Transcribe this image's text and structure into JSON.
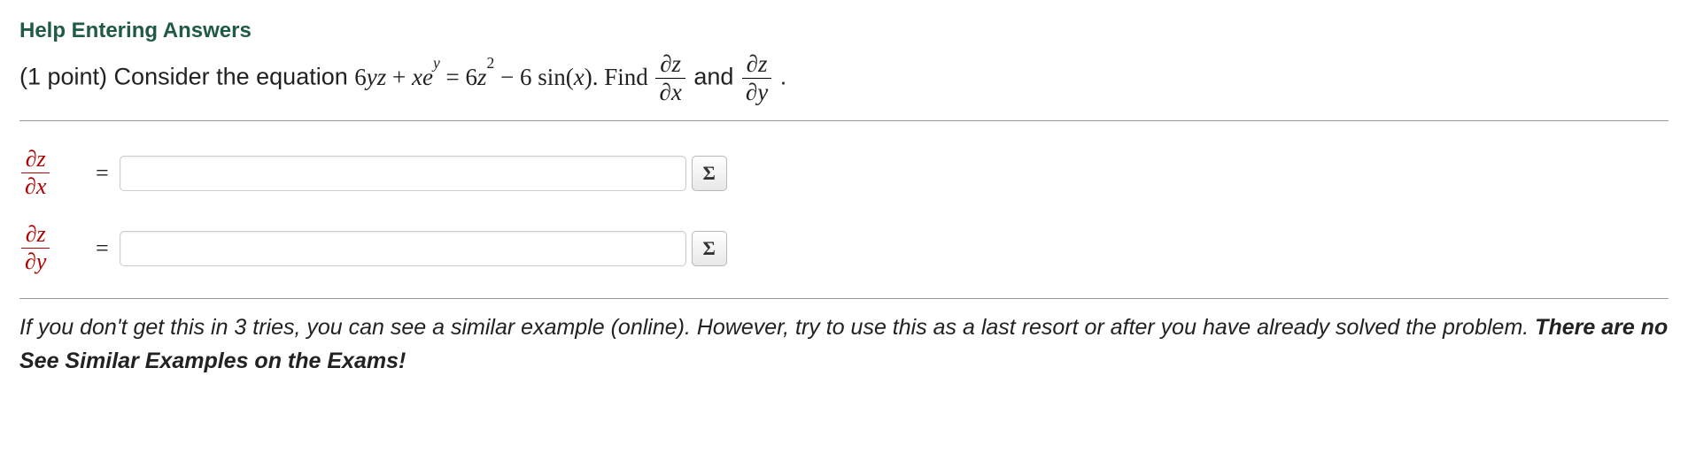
{
  "help_link": "Help Entering Answers",
  "problem": {
    "prefix": "(1 point) Consider the equation ",
    "eq_lhs_a": "6",
    "eq_lhs_b": " + ",
    "eq_rhs_a": " = 6",
    "eq_rhs_b": " − 6 sin(",
    "eq_rhs_c": "). Find ",
    "and_text": " and ",
    "period": " ."
  },
  "vars": {
    "y": "y",
    "z": "z",
    "x": "x",
    "e": "e",
    "dz": "∂z",
    "dx": "∂x",
    "dy": "∂y",
    "two": "2"
  },
  "answers": [
    {
      "frac_num": "∂z",
      "frac_den": "∂x",
      "value": ""
    },
    {
      "frac_num": "∂z",
      "frac_den": "∂y",
      "value": ""
    }
  ],
  "equals": "=",
  "sigma": "Σ",
  "hint": {
    "text": "If you don't get this in 3 tries, you can see a similar example (online). However, try to use this as a last resort or after you have already solved the problem. ",
    "bold": "There are no See Similar Examples on the Exams!"
  }
}
